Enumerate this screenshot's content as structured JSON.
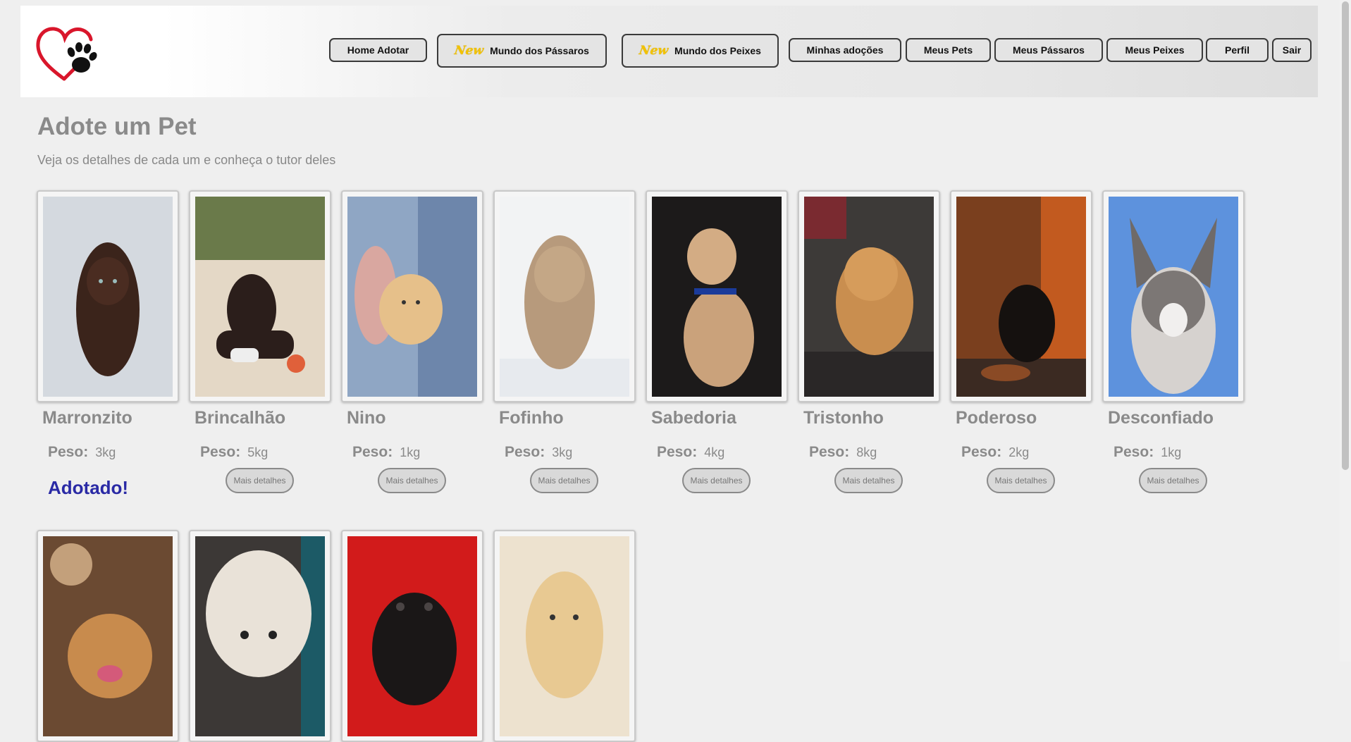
{
  "header": {
    "logo": "heart-paw-logo",
    "nav": [
      {
        "label": "Home Adotar",
        "badge": null
      },
      {
        "label": "Mundo dos Pássaros",
        "badge": "New"
      },
      {
        "label": "Mundo dos Peixes",
        "badge": "New"
      },
      {
        "label": "Minhas adoções",
        "badge": null
      },
      {
        "label": "Meus Pets",
        "badge": null
      },
      {
        "label": "Meus Pássaros",
        "badge": null
      },
      {
        "label": "Meus Peixes",
        "badge": null
      },
      {
        "label": "Perfil",
        "badge": null
      },
      {
        "label": "Sair",
        "badge": null
      }
    ]
  },
  "main": {
    "title": "Adote um Pet",
    "subtitle": "Veja os detalhes de cada um e conheça o tutor deles",
    "peso_label": "Peso:",
    "details_label": "Mais detalhes",
    "adopted_label": "Adotado!",
    "pets": [
      {
        "name": "Marronzito",
        "peso": "3kg",
        "adopted": true
      },
      {
        "name": "Brincalhão",
        "peso": "5kg",
        "adopted": false
      },
      {
        "name": "Nino",
        "peso": "1kg",
        "adopted": false
      },
      {
        "name": "Fofinho",
        "peso": "3kg",
        "adopted": false
      },
      {
        "name": "Sabedoria",
        "peso": "4kg",
        "adopted": false
      },
      {
        "name": "Tristonho",
        "peso": "8kg",
        "adopted": false
      },
      {
        "name": "Poderoso",
        "peso": "2kg",
        "adopted": false
      },
      {
        "name": "Desconfiado",
        "peso": "1kg",
        "adopted": false
      }
    ],
    "second_row_count": 4
  },
  "colors": {
    "page_bg": "#efefef",
    "title_gray": "#8a8a8a",
    "adopted_blue": "#2a2aa5",
    "new_badge_yellow": "#f2c200"
  }
}
